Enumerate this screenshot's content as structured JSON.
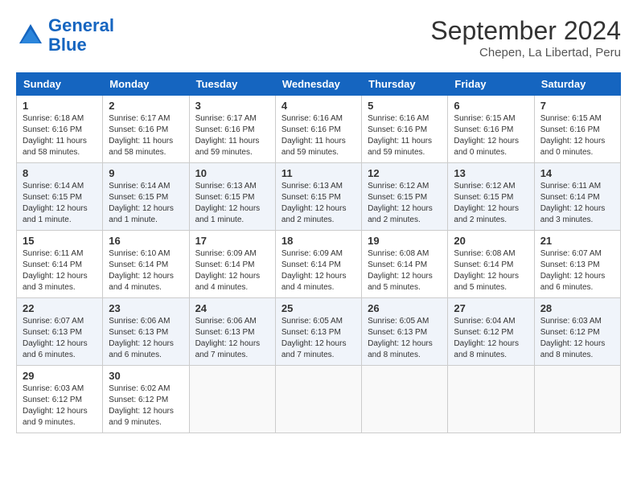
{
  "logo": {
    "line1": "General",
    "line2": "Blue"
  },
  "title": "September 2024",
  "location": "Chepen, La Libertad, Peru",
  "days_of_week": [
    "Sunday",
    "Monday",
    "Tuesday",
    "Wednesday",
    "Thursday",
    "Friday",
    "Saturday"
  ],
  "weeks": [
    [
      {
        "day": "1",
        "info": "Sunrise: 6:18 AM\nSunset: 6:16 PM\nDaylight: 11 hours and 58 minutes."
      },
      {
        "day": "2",
        "info": "Sunrise: 6:17 AM\nSunset: 6:16 PM\nDaylight: 11 hours and 58 minutes."
      },
      {
        "day": "3",
        "info": "Sunrise: 6:17 AM\nSunset: 6:16 PM\nDaylight: 11 hours and 59 minutes."
      },
      {
        "day": "4",
        "info": "Sunrise: 6:16 AM\nSunset: 6:16 PM\nDaylight: 11 hours and 59 minutes."
      },
      {
        "day": "5",
        "info": "Sunrise: 6:16 AM\nSunset: 6:16 PM\nDaylight: 11 hours and 59 minutes."
      },
      {
        "day": "6",
        "info": "Sunrise: 6:15 AM\nSunset: 6:16 PM\nDaylight: 12 hours and 0 minutes."
      },
      {
        "day": "7",
        "info": "Sunrise: 6:15 AM\nSunset: 6:16 PM\nDaylight: 12 hours and 0 minutes."
      }
    ],
    [
      {
        "day": "8",
        "info": "Sunrise: 6:14 AM\nSunset: 6:15 PM\nDaylight: 12 hours and 1 minute."
      },
      {
        "day": "9",
        "info": "Sunrise: 6:14 AM\nSunset: 6:15 PM\nDaylight: 12 hours and 1 minute."
      },
      {
        "day": "10",
        "info": "Sunrise: 6:13 AM\nSunset: 6:15 PM\nDaylight: 12 hours and 1 minute."
      },
      {
        "day": "11",
        "info": "Sunrise: 6:13 AM\nSunset: 6:15 PM\nDaylight: 12 hours and 2 minutes."
      },
      {
        "day": "12",
        "info": "Sunrise: 6:12 AM\nSunset: 6:15 PM\nDaylight: 12 hours and 2 minutes."
      },
      {
        "day": "13",
        "info": "Sunrise: 6:12 AM\nSunset: 6:15 PM\nDaylight: 12 hours and 2 minutes."
      },
      {
        "day": "14",
        "info": "Sunrise: 6:11 AM\nSunset: 6:14 PM\nDaylight: 12 hours and 3 minutes."
      }
    ],
    [
      {
        "day": "15",
        "info": "Sunrise: 6:11 AM\nSunset: 6:14 PM\nDaylight: 12 hours and 3 minutes."
      },
      {
        "day": "16",
        "info": "Sunrise: 6:10 AM\nSunset: 6:14 PM\nDaylight: 12 hours and 4 minutes."
      },
      {
        "day": "17",
        "info": "Sunrise: 6:09 AM\nSunset: 6:14 PM\nDaylight: 12 hours and 4 minutes."
      },
      {
        "day": "18",
        "info": "Sunrise: 6:09 AM\nSunset: 6:14 PM\nDaylight: 12 hours and 4 minutes."
      },
      {
        "day": "19",
        "info": "Sunrise: 6:08 AM\nSunset: 6:14 PM\nDaylight: 12 hours and 5 minutes."
      },
      {
        "day": "20",
        "info": "Sunrise: 6:08 AM\nSunset: 6:14 PM\nDaylight: 12 hours and 5 minutes."
      },
      {
        "day": "21",
        "info": "Sunrise: 6:07 AM\nSunset: 6:13 PM\nDaylight: 12 hours and 6 minutes."
      }
    ],
    [
      {
        "day": "22",
        "info": "Sunrise: 6:07 AM\nSunset: 6:13 PM\nDaylight: 12 hours and 6 minutes."
      },
      {
        "day": "23",
        "info": "Sunrise: 6:06 AM\nSunset: 6:13 PM\nDaylight: 12 hours and 6 minutes."
      },
      {
        "day": "24",
        "info": "Sunrise: 6:06 AM\nSunset: 6:13 PM\nDaylight: 12 hours and 7 minutes."
      },
      {
        "day": "25",
        "info": "Sunrise: 6:05 AM\nSunset: 6:13 PM\nDaylight: 12 hours and 7 minutes."
      },
      {
        "day": "26",
        "info": "Sunrise: 6:05 AM\nSunset: 6:13 PM\nDaylight: 12 hours and 8 minutes."
      },
      {
        "day": "27",
        "info": "Sunrise: 6:04 AM\nSunset: 6:12 PM\nDaylight: 12 hours and 8 minutes."
      },
      {
        "day": "28",
        "info": "Sunrise: 6:03 AM\nSunset: 6:12 PM\nDaylight: 12 hours and 8 minutes."
      }
    ],
    [
      {
        "day": "29",
        "info": "Sunrise: 6:03 AM\nSunset: 6:12 PM\nDaylight: 12 hours and 9 minutes."
      },
      {
        "day": "30",
        "info": "Sunrise: 6:02 AM\nSunset: 6:12 PM\nDaylight: 12 hours and 9 minutes."
      },
      {
        "day": "",
        "info": ""
      },
      {
        "day": "",
        "info": ""
      },
      {
        "day": "",
        "info": ""
      },
      {
        "day": "",
        "info": ""
      },
      {
        "day": "",
        "info": ""
      }
    ]
  ]
}
